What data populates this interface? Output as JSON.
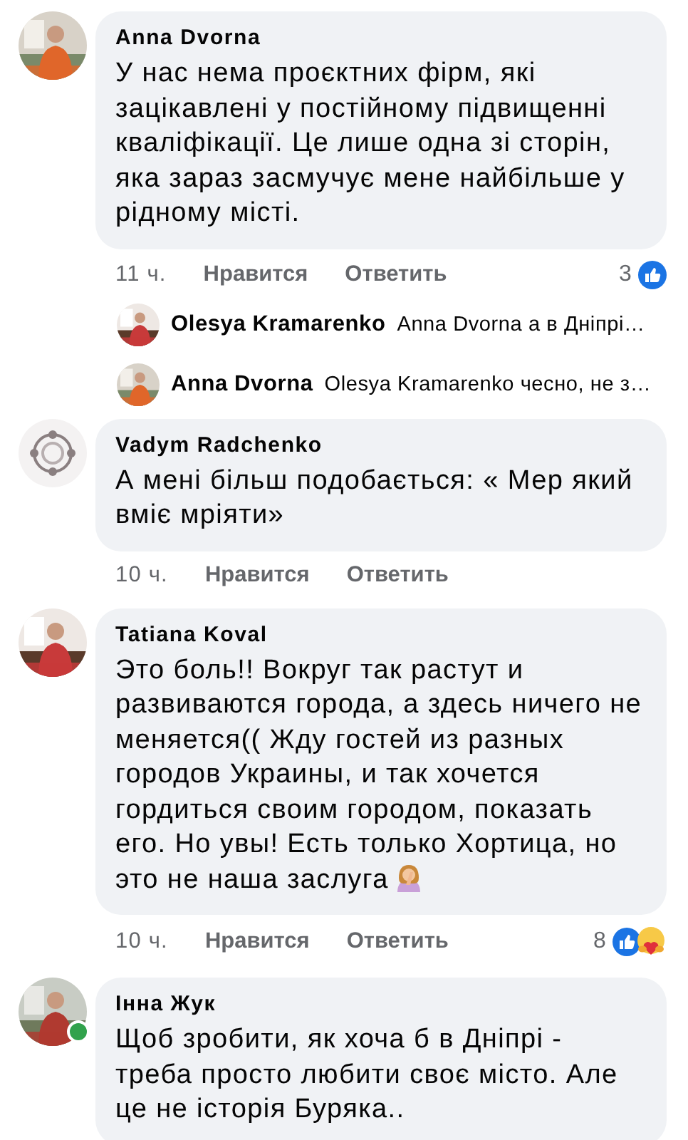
{
  "comments": [
    {
      "name": "Anna Dvorna",
      "online": false,
      "text": "У нас нема проєктних фірм, які зацікавлені у постійному підвищенні кваліфікації. Це лише одна зі сторін, яка зараз засмучує мене найбільше у рідному місті.",
      "time": "11 ч.",
      "like": "Нравится",
      "reply": "Ответить",
      "reaction_count": "3",
      "reactions": [
        {
          "kind": "like"
        }
      ],
      "replies": [
        {
          "name": "Olesya Kramarenko",
          "text": "Anna Dvorna а в Дніпрі…"
        },
        {
          "name": "Anna Dvorna",
          "text": "Olesya Kramarenko чесно, не з…"
        }
      ]
    },
    {
      "name": "Vadym Radchenko",
      "online": false,
      "text": "А мені більш подобається: « Мер який вміє мріяти»",
      "time": "10 ч.",
      "like": "Нравится",
      "reply": "Ответить"
    },
    {
      "name": "Tatiana Koval",
      "online": false,
      "text": "Это боль!! Вокруг так растут и развиваются  города, а здесь ничего не меняется(( Жду гостей из разных городов Украины, и так хочется гордиться своим городом, показать его. Но увы! Есть только Хортица, но это не наша заслуга",
      "emoji": {
        "kind": "facepalm"
      },
      "time": "10 ч.",
      "like": "Нравится",
      "reply": "Ответить",
      "reaction_count": "8",
      "reactions": [
        {
          "kind": "like"
        },
        {
          "kind": "care"
        }
      ]
    },
    {
      "name": "Інна Жук",
      "online": true,
      "text": "Щоб зробити, як хоча б в Дніпрі - треба просто любити своє місто. Але це не історія Буряка.."
    }
  ]
}
